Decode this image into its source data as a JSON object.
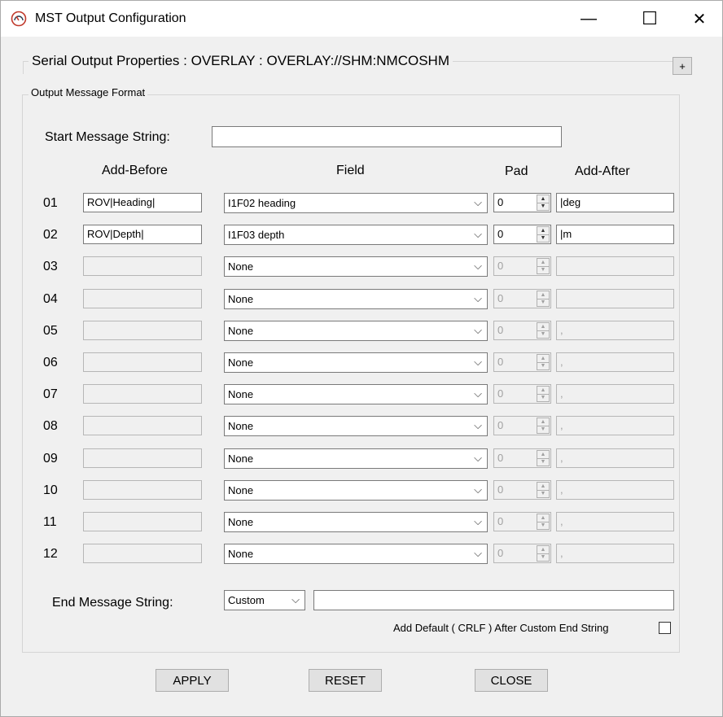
{
  "window": {
    "title": "MST Output Configuration",
    "minimize": "—",
    "maximize": "☐",
    "close": "✕"
  },
  "serial_group": {
    "label": "Serial Output Properties : OVERLAY : OVERLAY://SHM:NMCOSHM",
    "expand": "+"
  },
  "format_group": {
    "label": "Output Message Format",
    "start_label": "Start Message String:",
    "start_value": "",
    "headers": {
      "add_before": "Add-Before",
      "field": "Field",
      "pad": "Pad",
      "add_after": "Add-After"
    },
    "rows": [
      {
        "num": "01",
        "before": "ROV|Heading|",
        "field": "I1F02 heading",
        "pad": "0",
        "after": "|deg",
        "enabled": true
      },
      {
        "num": "02",
        "before": "ROV|Depth|",
        "field": "I1F03 depth",
        "pad": "0",
        "after": "|m",
        "enabled": true
      },
      {
        "num": "03",
        "before": "",
        "field": "None",
        "pad": "0",
        "after": "",
        "enabled": false
      },
      {
        "num": "04",
        "before": "",
        "field": "None",
        "pad": "0",
        "after": "",
        "enabled": false
      },
      {
        "num": "05",
        "before": "",
        "field": "None",
        "pad": "0",
        "after": ",",
        "enabled": false
      },
      {
        "num": "06",
        "before": "",
        "field": "None",
        "pad": "0",
        "after": ",",
        "enabled": false
      },
      {
        "num": "07",
        "before": "",
        "field": "None",
        "pad": "0",
        "after": ",",
        "enabled": false
      },
      {
        "num": "08",
        "before": "",
        "field": "None",
        "pad": "0",
        "after": ",",
        "enabled": false
      },
      {
        "num": "09",
        "before": "",
        "field": "None",
        "pad": "0",
        "after": ",",
        "enabled": false
      },
      {
        "num": "10",
        "before": "",
        "field": "None",
        "pad": "0",
        "after": ",",
        "enabled": false
      },
      {
        "num": "11",
        "before": "",
        "field": "None",
        "pad": "0",
        "after": ",",
        "enabled": false
      },
      {
        "num": "12",
        "before": "",
        "field": "None",
        "pad": "0",
        "after": ",",
        "enabled": false
      }
    ],
    "end_label": "End Message String:",
    "end_select": "Custom",
    "end_value": "",
    "crlf_label": "Add Default ( CRLF ) After Custom End String",
    "crlf_checked": false
  },
  "buttons": {
    "apply": "APPLY",
    "reset": "RESET",
    "close": "CLOSE"
  },
  "icons": {
    "app": "gauge-icon",
    "dropdown": "chevron-down-icon",
    "spin_up": "▲",
    "spin_down": "▼",
    "chevron": "⌵"
  }
}
